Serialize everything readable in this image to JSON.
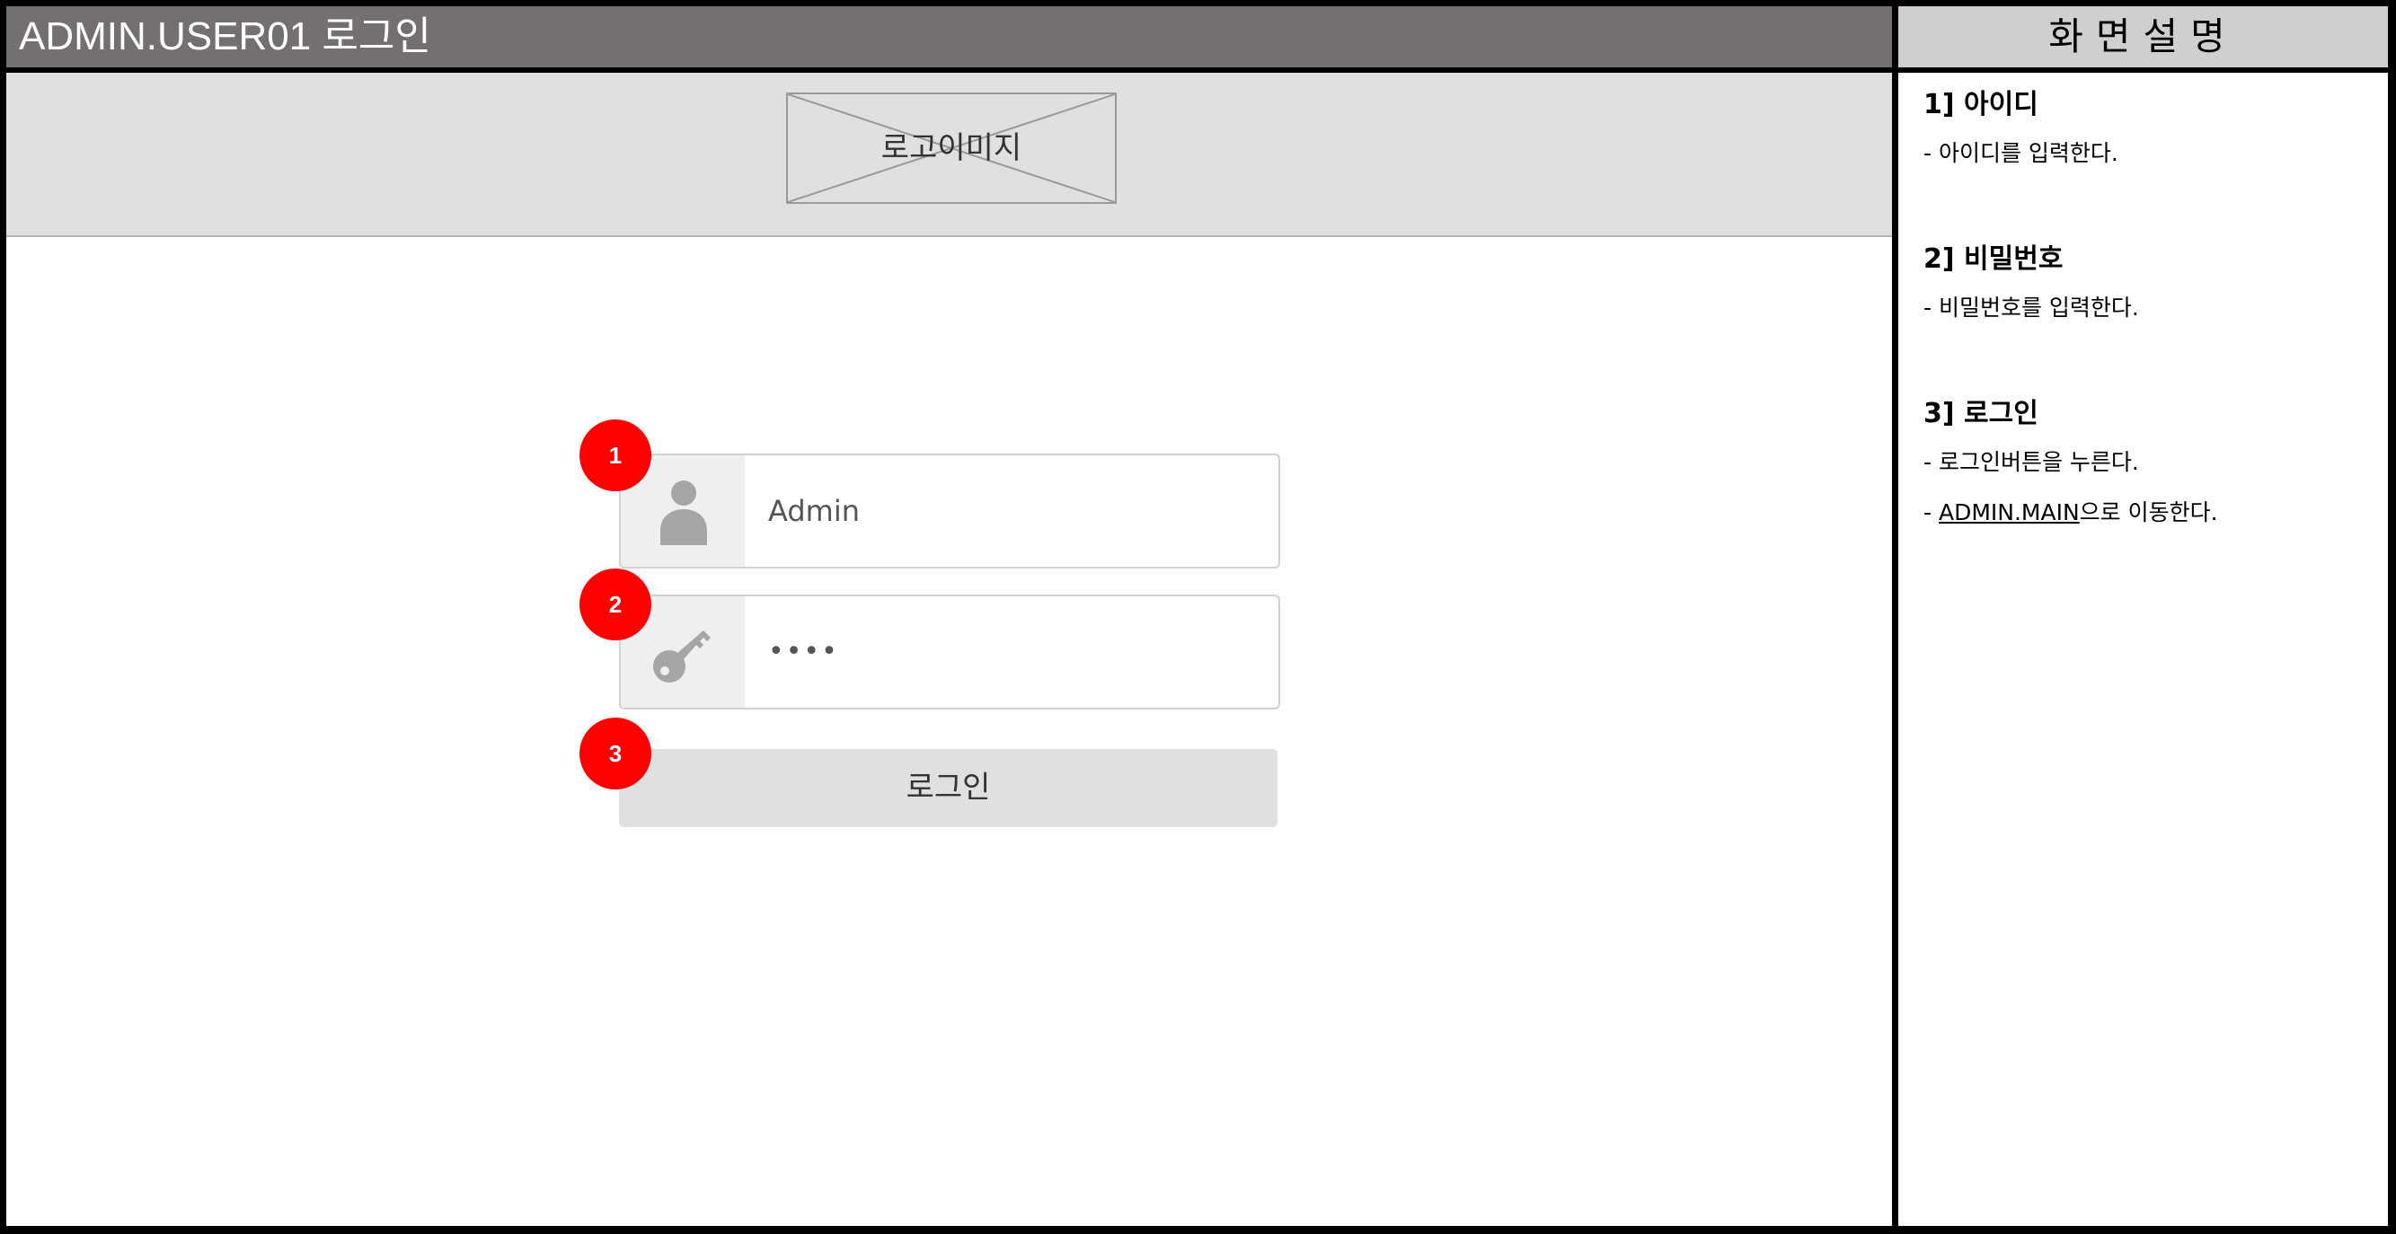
{
  "screen": {
    "title": "ADMIN.USER01 로그인",
    "logo_placeholder_label": "로고이미지"
  },
  "login_form": {
    "username": {
      "value": "Admin",
      "icon": "user-icon"
    },
    "password": {
      "value": "••••",
      "icon": "key-icon"
    },
    "login_button_label": "로그인"
  },
  "markers": [
    "1",
    "2",
    "3"
  ],
  "description_panel": {
    "header": "화면설명",
    "sections": [
      {
        "title": "1] 아이디",
        "lines": [
          "- 아이디를 입력한다."
        ]
      },
      {
        "title": "2] 비밀번호",
        "lines": [
          "- 비밀번호를 입력한다."
        ]
      },
      {
        "title": "3] 로그인",
        "lines": [
          "- 로그인버튼을 누른다."
        ],
        "link_line": {
          "prefix": "- ",
          "link": "ADMIN.MAIN",
          "suffix": "으로 이동한다."
        }
      }
    ]
  },
  "colors": {
    "title_bar": "#747070",
    "marker": "#ff0000",
    "desc_header": "#d0cece",
    "logo_band": "#e0e0e0",
    "icon_gray": "#a6a6a6"
  }
}
